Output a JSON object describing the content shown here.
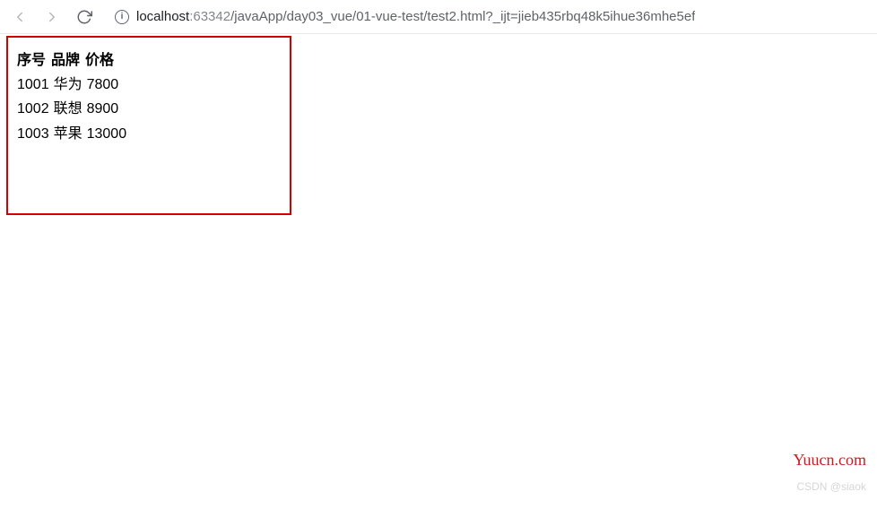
{
  "toolbar": {
    "url_host": "localhost",
    "url_port": ":63342",
    "url_path": "/javaApp/day03_vue/01-vue-test/test2.html?_ijt=jieb435rbq48k5ihue36mhe5ef"
  },
  "table": {
    "headers": [
      "序号",
      "品牌",
      "价格"
    ],
    "rows": [
      {
        "id": "1001",
        "brand": "华为",
        "price": "7800"
      },
      {
        "id": "1002",
        "brand": "联想",
        "price": "8900"
      },
      {
        "id": "1003",
        "brand": "苹果",
        "price": "13000"
      }
    ]
  },
  "watermark": {
    "site": "Yuucn.com",
    "csdn": "CSDN @siaok"
  }
}
